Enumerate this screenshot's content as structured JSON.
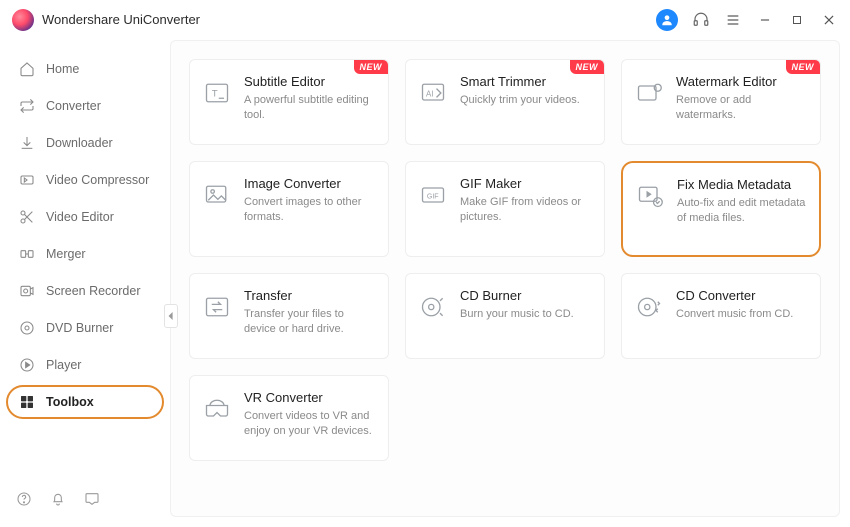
{
  "app": {
    "title": "Wondershare UniConverter"
  },
  "sidebar": {
    "items": [
      {
        "label": "Home"
      },
      {
        "label": "Converter"
      },
      {
        "label": "Downloader"
      },
      {
        "label": "Video Compressor"
      },
      {
        "label": "Video Editor"
      },
      {
        "label": "Merger"
      },
      {
        "label": "Screen Recorder"
      },
      {
        "label": "DVD Burner"
      },
      {
        "label": "Player"
      },
      {
        "label": "Toolbox"
      }
    ]
  },
  "badges": {
    "new": "NEW"
  },
  "toolbox": {
    "cards": [
      {
        "title": "Subtitle Editor",
        "desc": "A powerful subtitle editing tool.",
        "new": true
      },
      {
        "title": "Smart Trimmer",
        "desc": "Quickly trim your videos.",
        "new": true
      },
      {
        "title": "Watermark Editor",
        "desc": "Remove or add watermarks.",
        "new": true
      },
      {
        "title": "Image Converter",
        "desc": "Convert images to other formats."
      },
      {
        "title": "GIF Maker",
        "desc": "Make GIF from videos or pictures."
      },
      {
        "title": "Fix Media Metadata",
        "desc": "Auto-fix and edit metadata of media files.",
        "highlight": true
      },
      {
        "title": "Transfer",
        "desc": "Transfer your files to device or hard drive."
      },
      {
        "title": "CD Burner",
        "desc": "Burn your music to CD."
      },
      {
        "title": "CD Converter",
        "desc": "Convert music from CD."
      },
      {
        "title": "VR Converter",
        "desc": "Convert videos to VR and enjoy on your VR devices."
      }
    ]
  }
}
